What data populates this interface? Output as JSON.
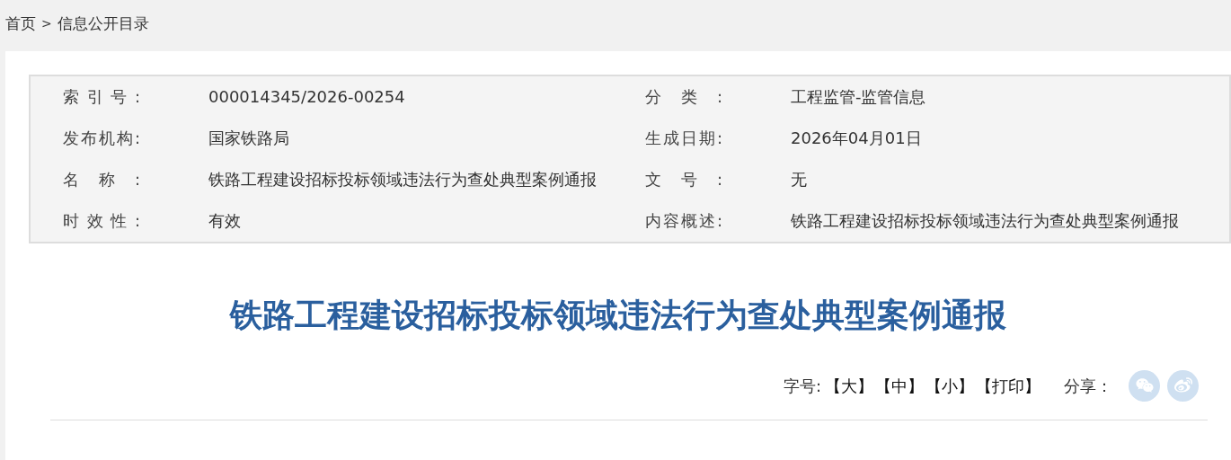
{
  "breadcrumb": {
    "items": [
      {
        "label": "首页"
      },
      {
        "label": "信息公开目录"
      }
    ],
    "separator": ">"
  },
  "info": {
    "left": [
      {
        "label": "索引号:",
        "value": "000014345/2026-00254"
      },
      {
        "label": "发布机构:",
        "value": "国家铁路局"
      },
      {
        "label": "名称:",
        "value": "铁路工程建设招标投标领域违法行为查处典型案例通报"
      },
      {
        "label": "时效性:",
        "value": "有效"
      }
    ],
    "right": [
      {
        "label": "分类:",
        "value": "工程监管-监管信息"
      },
      {
        "label": "生成日期:",
        "value": "2026年04月01日"
      },
      {
        "label": "文号:",
        "value": "无"
      },
      {
        "label": "内容概述:",
        "value": "铁路工程建设招标投标领域违法行为查处典型案例通报"
      }
    ]
  },
  "title": "铁路工程建设招标投标领域违法行为查处典型案例通报",
  "tools": {
    "font_size_label": "字号:",
    "options": [
      "【大】",
      "【中】",
      "【小】",
      "【打印】"
    ],
    "share_label": "分享：",
    "share": [
      {
        "kind": "wechat"
      },
      {
        "kind": "weibo"
      }
    ]
  }
}
